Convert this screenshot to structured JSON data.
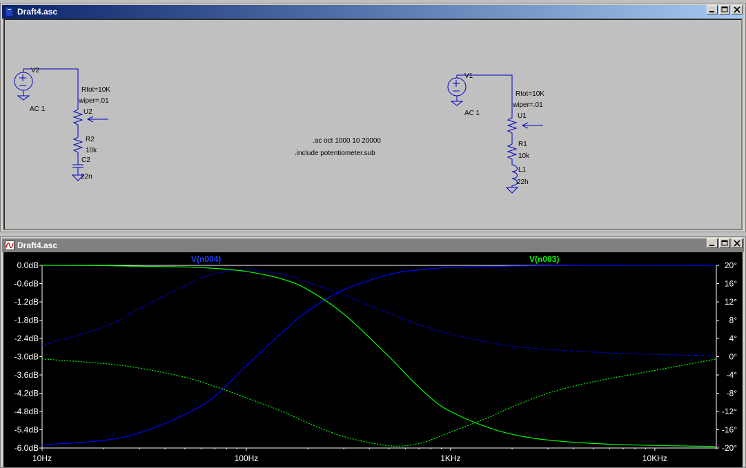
{
  "schematic_window": {
    "title": "Draft4.asc",
    "labels": {
      "v2": "V2",
      "v2_ac": "AC 1",
      "rtot_left": "Rtot=10K",
      "wiper_left": "wiper=.01",
      "u2": "U2",
      "r2": "R2",
      "r2_val": "10k",
      "c2": "C2",
      "c2_val": "22n",
      "directive_ac": ".ac oct 1000 10 20000",
      "directive_include": ".include potentiometer.sub",
      "v1": "V1",
      "v1_ac": "AC 1",
      "rtot_right": "Rtot=10K",
      "wiper_right": "wiper=.01",
      "u1": "U1",
      "r1": "R1",
      "r1_val": "10k",
      "l1": "L1",
      "l1_val": "22h"
    }
  },
  "plot_window": {
    "title": "Draft4.asc",
    "trace_labels": {
      "blue": "V(n004)",
      "green": "V(n003)"
    },
    "y_left_ticks": [
      "0.0dB",
      "-0.6dB",
      "-1.2dB",
      "-1.8dB",
      "-2.4dB",
      "-3.0dB",
      "-3.6dB",
      "-4.2dB",
      "-4.8dB",
      "-5.4dB",
      "-6.0dB"
    ],
    "y_right_ticks": [
      "20°",
      "16°",
      "12°",
      "8°",
      "4°",
      "0°",
      "-4°",
      "-8°",
      "-12°",
      "-16°",
      "-20°"
    ],
    "x_ticks": [
      "10Hz",
      "100Hz",
      "1KHz",
      "10KHz"
    ]
  },
  "chart_data": {
    "type": "line",
    "xlabel": "",
    "ylabel": "",
    "x_scale": "log",
    "xlim": [
      10,
      20000
    ],
    "ylim_left": [
      -6.0,
      0.0
    ],
    "ylim_right": [
      -20,
      20
    ],
    "series": [
      {
        "name": "V(n004)",
        "color": "#0000ff",
        "style": "solid",
        "axis": "left",
        "x": [
          10,
          20,
          30,
          50,
          70,
          100,
          150,
          200,
          300,
          500,
          700,
          1000,
          2000,
          5000,
          20000
        ],
        "y": [
          -5.9,
          -5.75,
          -5.5,
          -4.9,
          -4.3,
          -3.3,
          -2.2,
          -1.5,
          -0.8,
          -0.3,
          -0.15,
          -0.07,
          -0.02,
          0.0,
          0.0
        ]
      },
      {
        "name": "V(n004) phase",
        "color": "#0000ff",
        "style": "dotted",
        "axis": "right",
        "x": [
          10,
          20,
          30,
          50,
          70,
          100,
          150,
          200,
          300,
          500,
          700,
          1000,
          2000,
          5000,
          10000,
          20000
        ],
        "y": [
          2.5,
          6.5,
          10.5,
          15.5,
          18.2,
          19.0,
          18.0,
          16.3,
          13.5,
          9.5,
          7.0,
          5.0,
          2.3,
          1.0,
          0.5,
          0.2
        ]
      },
      {
        "name": "V(n003)",
        "color": "#00ff00",
        "style": "solid",
        "axis": "left",
        "x": [
          10,
          20,
          30,
          50,
          70,
          100,
          150,
          200,
          300,
          500,
          700,
          1000,
          2000,
          5000,
          20000
        ],
        "y": [
          0.0,
          -0.01,
          -0.03,
          -0.05,
          -0.1,
          -0.2,
          -0.45,
          -0.8,
          -1.6,
          -3.0,
          -4.0,
          -4.8,
          -5.55,
          -5.85,
          -5.95
        ]
      },
      {
        "name": "V(n003) phase",
        "color": "#00ff00",
        "style": "dotted",
        "axis": "right",
        "x": [
          10,
          20,
          30,
          50,
          70,
          100,
          150,
          200,
          300,
          500,
          700,
          1000,
          1500,
          2000,
          3000,
          5000,
          10000,
          20000
        ],
        "y": [
          -0.5,
          -1.5,
          -2.5,
          -4.5,
          -6.5,
          -9.0,
          -12.0,
          -14.5,
          -17.5,
          -19.5,
          -19.0,
          -16.5,
          -13.5,
          -11.0,
          -8.0,
          -5.5,
          -3.0,
          -0.5
        ]
      }
    ]
  }
}
